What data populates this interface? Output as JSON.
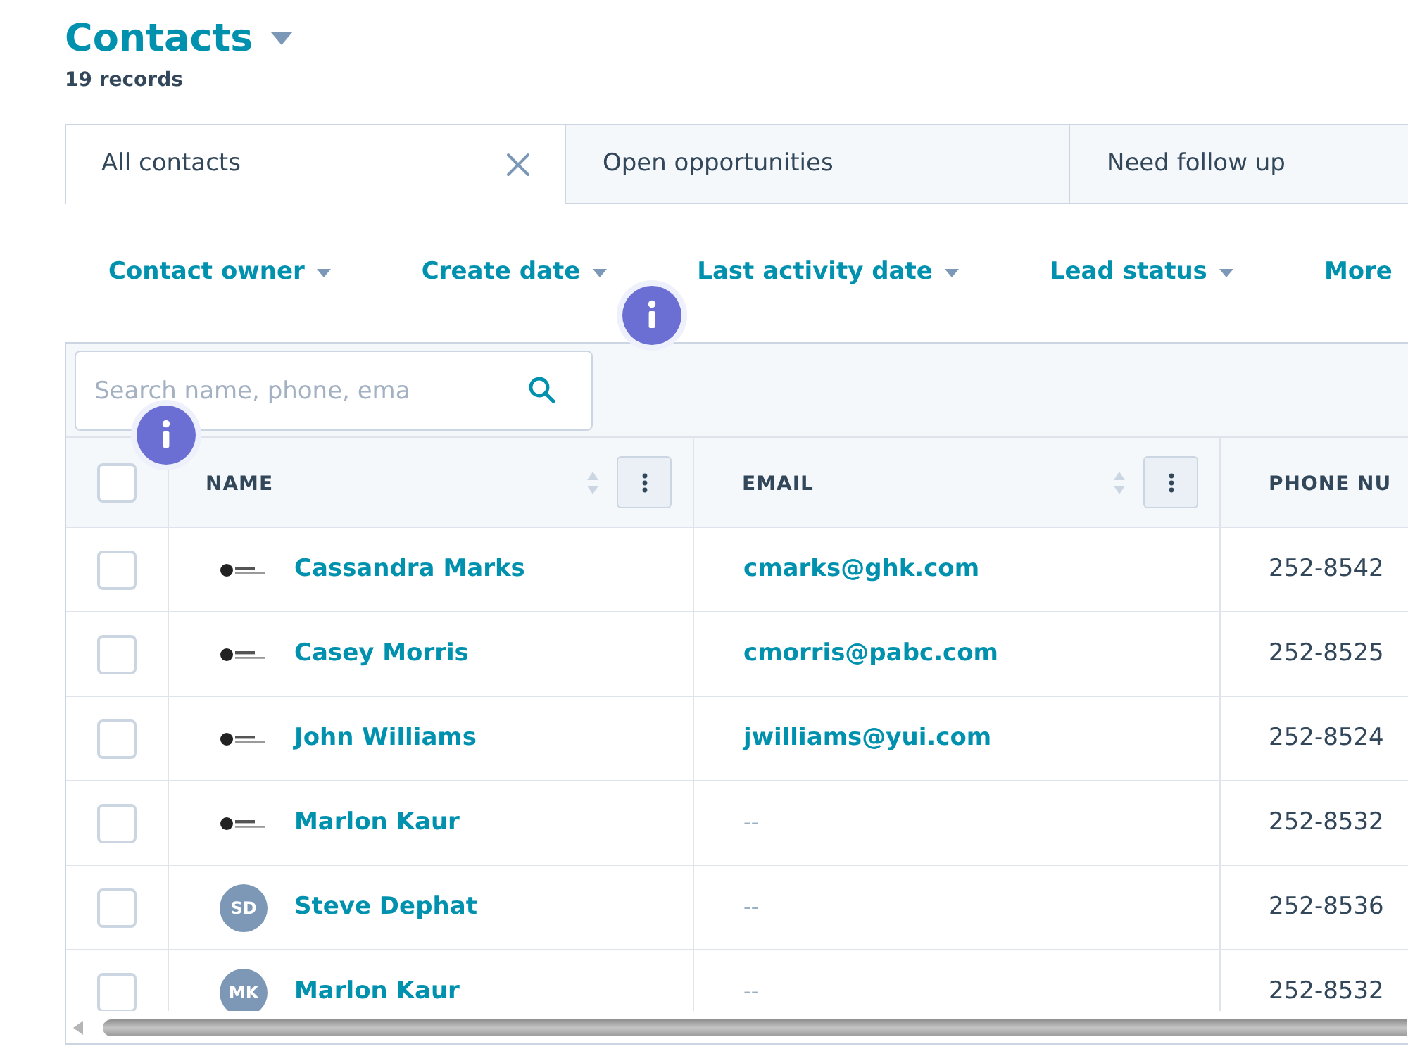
{
  "page": {
    "title": "Contacts",
    "record_count": "19 records"
  },
  "tabs": [
    {
      "label": "All contacts",
      "selected": true
    },
    {
      "label": "Open opportunities",
      "selected": false
    },
    {
      "label": "Need follow up",
      "selected": false
    }
  ],
  "filters": [
    {
      "label": "Contact owner",
      "dropdown": true
    },
    {
      "label": "Create date",
      "dropdown": true
    },
    {
      "label": "Last activity date",
      "dropdown": true
    },
    {
      "label": "Lead status",
      "dropdown": true
    },
    {
      "label": "More",
      "dropdown": false
    }
  ],
  "table": {
    "search": {
      "placeholder": "Search name, phone, ema"
    },
    "select_all": {
      "checked": false
    },
    "columns": [
      {
        "label": "NAME",
        "sortable": true,
        "menu": true
      },
      {
        "label": "EMAIL",
        "sortable": true,
        "menu": true
      },
      {
        "label": "PHONE NU"
      }
    ],
    "rows": [
      {
        "checked": false,
        "avatar": {
          "kind": "logo"
        },
        "name": "Cassandra Marks",
        "email": {
          "kind": "link",
          "text": "cmarks@ghk.com"
        },
        "phone": "252-8542"
      },
      {
        "checked": false,
        "avatar": {
          "kind": "logo"
        },
        "name": "Casey Morris",
        "email": {
          "kind": "link",
          "text": "cmorris@pabc.com"
        },
        "phone": "252-8525"
      },
      {
        "checked": false,
        "avatar": {
          "kind": "logo"
        },
        "name": "John Williams",
        "email": {
          "kind": "link",
          "text": "jwilliams@yui.com"
        },
        "phone": "252-8524"
      },
      {
        "checked": false,
        "avatar": {
          "kind": "logo"
        },
        "name": "Marlon Kaur",
        "email": {
          "kind": "empty",
          "text": "--"
        },
        "phone": "252-8532"
      },
      {
        "checked": false,
        "avatar": {
          "kind": "initials",
          "text": "SD"
        },
        "name": "Steve Dephat",
        "email": {
          "kind": "empty",
          "text": "--"
        },
        "phone": "252-8536"
      },
      {
        "checked": false,
        "avatar": {
          "kind": "initials",
          "text": "MK"
        },
        "name": "Marlon Kaur",
        "email": {
          "kind": "empty",
          "text": "--"
        },
        "phone": "252-8532"
      }
    ]
  }
}
